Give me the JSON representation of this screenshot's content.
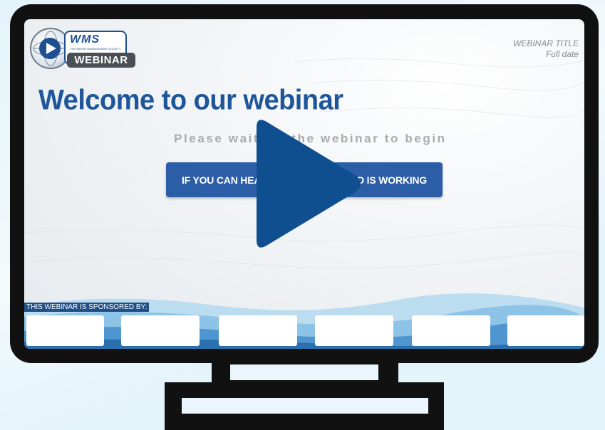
{
  "logo": {
    "org_abbr": "WMS",
    "org_tagline": "THE WATER MANAGEMENT SOCIETY",
    "badge_text": "WEBINAR",
    "globe_icon": "globe-play-icon"
  },
  "header": {
    "webinar_title": "WEBINAR TITLE",
    "date": "Full date"
  },
  "main": {
    "welcome": "Welcome to our webinar",
    "subtitle": "Please wait for the webinar to begin",
    "audio_button": "IF YOU CAN HEAR THIS, YOUR SOUND IS WORKING"
  },
  "video": {
    "play_icon": "play-icon",
    "accent_color": "#0f4f8f"
  },
  "sponsors": {
    "label": "THIS WEBINAR IS SPONSORED BY:",
    "slots": [
      "",
      "",
      "",
      "",
      "",
      ""
    ]
  },
  "colors": {
    "brand_blue": "#1f5599",
    "button_blue": "#2b5ea7",
    "frame": "#111111",
    "background": "#e3f4fa"
  }
}
